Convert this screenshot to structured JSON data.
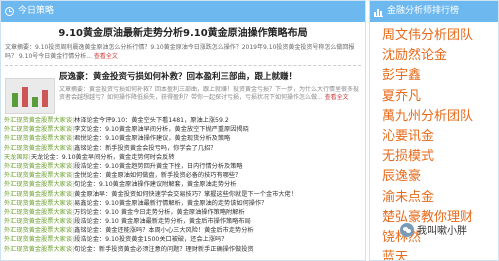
{
  "left_panel": {
    "header": "今日策略",
    "header_icon": "clock-icon",
    "article1": {
      "title": "9.10黄金原油最新走势分析9.10黄金原油操作策略布局",
      "summary": "文章摘要：9.10投资周利晨逸黄金原油怎么分析行情？9.10黄金原油今日涨跌怎么操作？2019年9.10投资黄金投资号称怎么做回报吗？ 9.10号今日黄金行情分析...",
      "more": "查看全文"
    },
    "article2": {
      "title": "辰逸豪：黄金投资亏损如何补救？回本盈利三部曲，跟上就赚！",
      "summary": "文章摘要：黄金投资亏损如何补救？回本盈利三部曲，跟上就赚！投资黄金亏损？下一步，为什么大行情里很多投资者会越想越亏？如何操作降低损失，获得盈利？带你一起探讨亏损，亏损状况下如何操作怎么做...",
      "more": "查看全文"
    },
    "news": [
      {
        "source": "外汇现货黄金股票大家谈",
        "text": "林泽论金今评9.10：黄金空头下看1481，原油上涨59.2"
      },
      {
        "source": "外汇现货黄金股票大家谈",
        "text": "李文论金：9.10黄金原油早间分析，黄金放空下抛严重原因揭晓"
      },
      {
        "source": "外汇现货黄金股票大家谈",
        "text": "君悦论金：9.10黄金原油操作建议，黄金现货分析及策略"
      },
      {
        "source": "外汇现货黄金股票大家谈",
        "text": "鑫铭论金：新手投资黄金会投亏吗，你学会了几招？"
      },
      {
        "source": "天龙国际",
        "text": "天龙论金：9.10黄金早间分析，黄金走势何时会反转"
      },
      {
        "source": "外汇现货黄金股票大家谈",
        "text": "段浩论金：9.10黄金趋势回升黄金下挫，日内行情分析及策略"
      },
      {
        "source": "外汇现货黄金股票大家谈",
        "text": "金悦论金：黄金原油如何做盘，新手投资必备的技巧有哪些？"
      },
      {
        "source": "外汇现货黄金股票大家谈",
        "text": "旬论金：9.10黄金原油操作建议附解套，黄金原油走势分析"
      },
      {
        "source": "外汇现货黄金股票大家谈",
        "text": "黄金原油早：黄金投资如何快速学会交易技巧？掌握这些你就是下一个金市大佬！"
      },
      {
        "source": "外汇现货黄金股票大家谈",
        "text": "易鑫论金：9.10黄金原油最新行情解析，黄金原油的走势该如何操作？"
      },
      {
        "source": "外汇现货黄金股票大家谈",
        "text": "万钧论金：9.10 黄金今日走势分析，黄金原油操作策略附解析"
      },
      {
        "source": "外汇现货黄金股票大家谈",
        "text": "段浩论金：9.10 黄金原油最新走势分析，黄金后市操作策略布局"
      },
      {
        "source": "外汇现货黄金股票大家谈",
        "text": "鑫铭论金：黄金还能涨吗？本周小心三大风险！黄金后市走势分析"
      },
      {
        "source": "外汇现货黄金股票大家谈",
        "text": "段浩论金：9.10投资黄金1500关口被破，还会上涨吗？"
      },
      {
        "source": "外汇现货黄金股票大家谈",
        "text": "旬论金：新手投资黄金必须注意的问题？理财新手正确操作做投资"
      }
    ]
  },
  "right_panel": {
    "header": "金融分析师排行榜",
    "header_icon": "bar-chart-icon",
    "ranking": [
      "周文伟分析团队",
      "沈励然论金",
      "彭宇鑫",
      "夏乔凡",
      "萬九州分析团队",
      "沁要讯金",
      "无损模式",
      "辰逸豪",
      "渝未点金",
      "楚弘豪教你理财",
      "饶林然",
      "蓝天"
    ]
  },
  "watermark": {
    "text": "我叫嗽小胖"
  }
}
